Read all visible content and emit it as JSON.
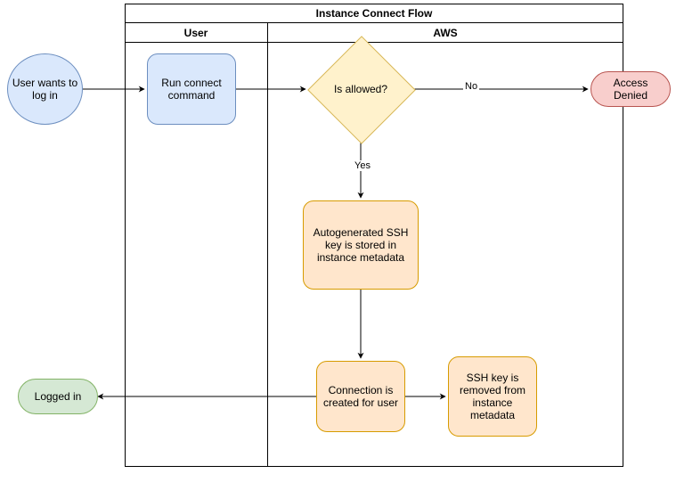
{
  "diagram": {
    "title": "Instance Connect Flow",
    "lanes": {
      "user": "User",
      "aws": "AWS"
    },
    "nodes": {
      "start": "User wants to log in",
      "run_connect": "Run connect command",
      "is_allowed": "Is allowed?",
      "access_denied": "Access Denied",
      "store_key": "Autogenerated SSH key is stored in instance metadata",
      "create_conn": "Connection is created for user",
      "remove_key": "SSH key is removed from instance metadata",
      "logged_in": "Logged in"
    },
    "edges": {
      "no": "No",
      "yes": "Yes"
    }
  }
}
